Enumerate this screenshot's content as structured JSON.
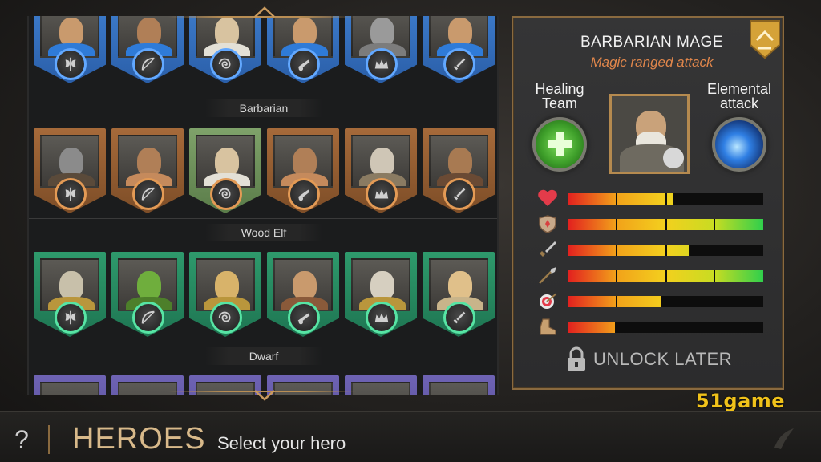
{
  "screen": {
    "title": "HEROES",
    "subtitle": "Select your hero",
    "help_label": "?"
  },
  "sections": [
    {
      "label": "Barbarian"
    },
    {
      "label": "Wood Elf"
    },
    {
      "label": "Dwarf"
    }
  ],
  "rows": [
    {
      "team": "human",
      "color": "#3f7fcf",
      "heroes": [
        "axe",
        "bow",
        "staff",
        "cannon",
        "crown",
        "sword"
      ]
    },
    {
      "team": "barbarian",
      "color": "#a66a3a",
      "heroes": [
        "axe",
        "bow",
        "staff",
        "cannon",
        "crown",
        "sword"
      ]
    },
    {
      "team": "wood-elf",
      "color": "#2e9a6c",
      "heroes": [
        "axe",
        "bow",
        "staff",
        "cannon",
        "crown",
        "sword"
      ]
    },
    {
      "team": "dwarf",
      "color": "#6e63b4",
      "heroes": []
    }
  ],
  "selected": {
    "name": "BARBARIAN MAGE",
    "subtitle": "Magic ranged attack",
    "skill_left": "Healing\nTeam",
    "skill_right": "Elemental\nattack",
    "skill_left_lines": [
      "Healing",
      "Team"
    ],
    "skill_right_lines": [
      "Elemental",
      "attack"
    ]
  },
  "stats": [
    {
      "icon": "heart-icon",
      "level": 0.54
    },
    {
      "icon": "shield-icon",
      "level": 1.0
    },
    {
      "icon": "sword-icon",
      "level": 0.62
    },
    {
      "icon": "spear-icon",
      "level": 1.0
    },
    {
      "icon": "target-icon",
      "level": 0.48
    },
    {
      "icon": "boot-icon",
      "level": 0.24
    }
  ],
  "unlock_label": "UNLOCK LATER",
  "watermark": "51game"
}
